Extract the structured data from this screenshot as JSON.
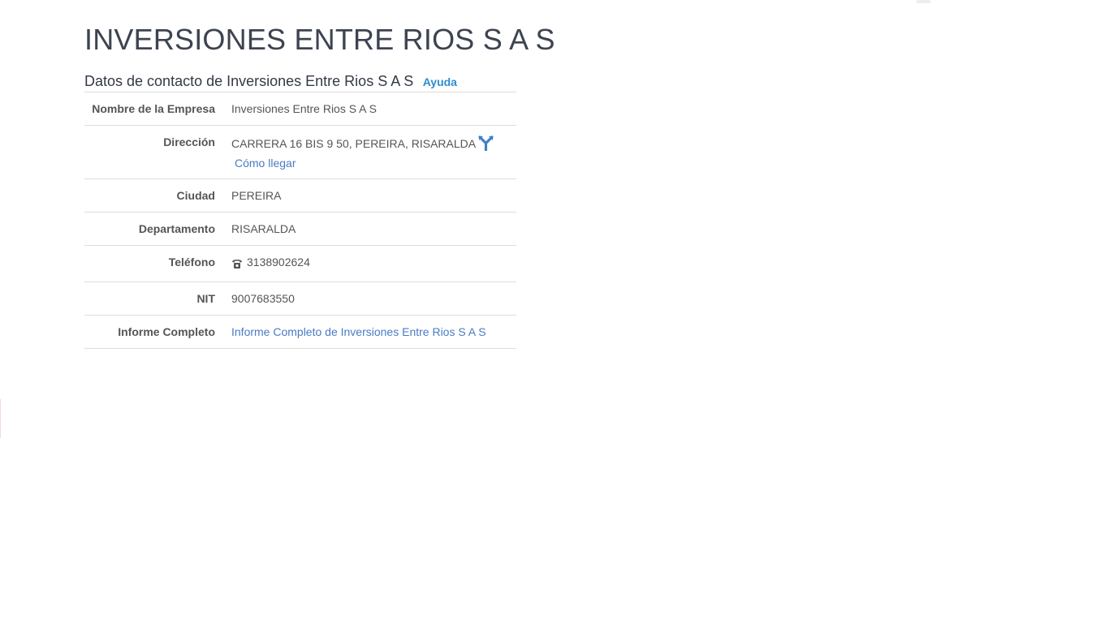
{
  "company": {
    "title": "INVERSIONES ENTRE RIOS S A S"
  },
  "contact_section": {
    "title": "Datos de contacto de Inversiones Entre Rios S A S",
    "help_link": "Ayuda"
  },
  "details": {
    "name": {
      "label": "Nombre de la Empresa",
      "value": "Inversiones Entre Rios S A S"
    },
    "address": {
      "label": "Dirección",
      "value": "CARRERA 16 BIS 9 50, PEREIRA, RISARALDA",
      "directions_link": "Cómo llegar",
      "icon": "route-icon"
    },
    "city": {
      "label": "Ciudad",
      "value": "PEREIRA"
    },
    "department": {
      "label": "Departamento",
      "value": "RISARALDA"
    },
    "phone": {
      "label": "Teléfono",
      "value": "3138902624",
      "icon": "phone-icon"
    },
    "nit": {
      "label": "NIT",
      "value": "9007683550"
    },
    "report": {
      "label": "Informe Completo",
      "link": "Informe Completo de Inversiones Entre Rios S A S"
    }
  },
  "colors": {
    "title": "#3d4450",
    "link": "#4a7bc4",
    "help_link": "#2f8dcd",
    "text": "#555555",
    "border": "#dddddd"
  }
}
